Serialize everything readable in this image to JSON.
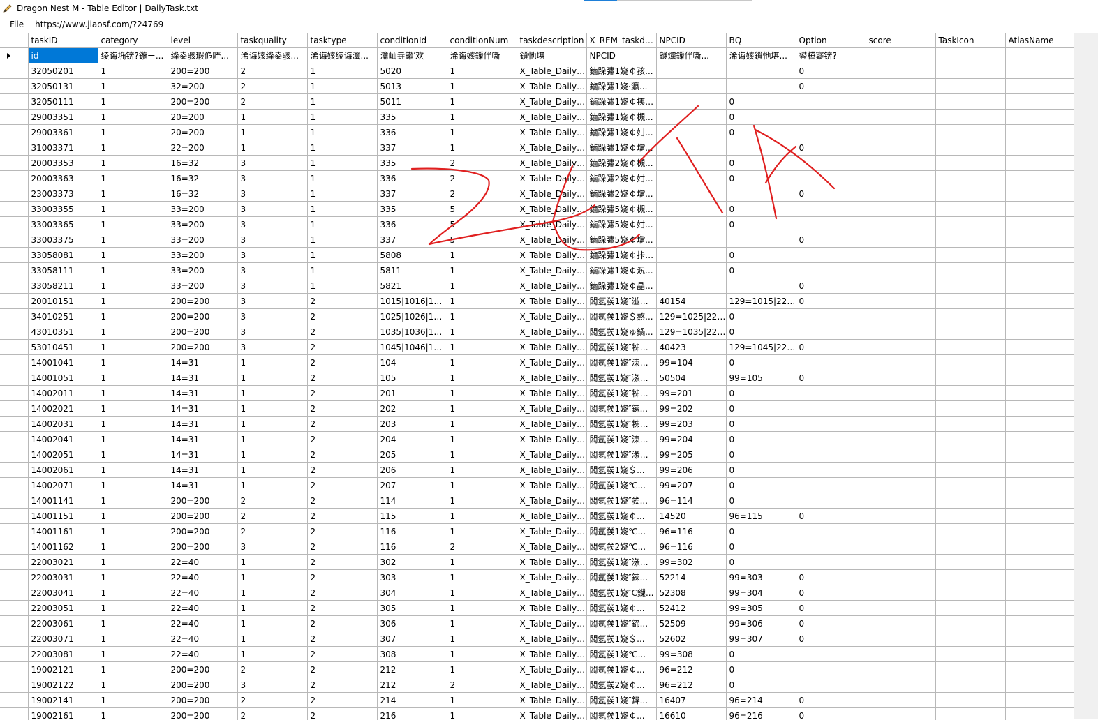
{
  "window": {
    "title": "Dragon Nest M - Table Editor | DailyTask.txt",
    "icon": "pencil-icon",
    "progress": 0.2
  },
  "menu": {
    "file_label": "File",
    "url_text": "https://www.jiaosf.com/?24769"
  },
  "grid": {
    "columns": [
      "taskID",
      "category",
      "level",
      "taskquality",
      "tasktype",
      "conditionId",
      "conditionNum",
      "taskdescription",
      "X_REM_taskdescri",
      "NPCID",
      "BQ",
      "Option",
      "score",
      "TaskIcon",
      "AtlasName"
    ],
    "header_row": [
      "id",
      "绫诲埆锛?鍦ㄧ...",
      "绛夌骇瑕佹眰...",
      "浠诲姟绛夌骇...",
      "浠诲姟绫诲瀷...",
      "瀹屾垚鏉′欢",
      "浠诲姟鏁伴噺",
      "鎻忚堪",
      "NPCID",
      "鐩爣鏁伴噺...",
      "浠诲姟鎻忚堪...",
      "鍙樺寲锛?",
      "",
      "",
      ""
    ],
    "rows": [
      [
        "32050201",
        "1",
        "200=200",
        "2",
        "1",
        "5020",
        "1",
        "X_Table_DailyTa...",
        "鏀跺彇1娆￠孩...",
        "",
        "",
        "0",
        "",
        "",
        ""
      ],
      [
        "32050131",
        "1",
        "32=200",
        "2",
        "1",
        "5013",
        "1",
        "X_Table_DailyTa...",
        "鏀跺彇1娆·瀛...",
        "",
        "",
        "0",
        "",
        "",
        ""
      ],
      [
        "32050111",
        "1",
        "200=200",
        "2",
        "1",
        "5011",
        "1",
        "X_Table_DailyTa...",
        "鏀跺彇1娆￠挗鍧?",
        "",
        "0",
        "",
        "",
        "",
        ""
      ],
      [
        "29003351",
        "1",
        "20=200",
        "1",
        "1",
        "335",
        "1",
        "X_Table_DailyTa...",
        "鏀跺彇1娆￠槻...",
        "",
        "0",
        "",
        "",
        "",
        ""
      ],
      [
        "29003361",
        "1",
        "20=200",
        "1",
        "1",
        "336",
        "1",
        "X_Table_DailyTa...",
        "鏀跺彇1娆￠姏...",
        "",
        "0",
        "",
        "",
        "",
        ""
      ],
      [
        "31003371",
        "1",
        "22=200",
        "1",
        "1",
        "337",
        "1",
        "X_Table_DailyTa...",
        "鏀跺彇1娆￠壋...",
        "",
        "",
        "0",
        "",
        "",
        ""
      ],
      [
        "20003353",
        "1",
        "16=32",
        "3",
        "1",
        "335",
        "2",
        "X_Table_DailyTa...",
        "鏀跺彇2娆￠槻...",
        "",
        "0",
        "",
        "",
        "",
        ""
      ],
      [
        "20003363",
        "1",
        "16=32",
        "3",
        "1",
        "336",
        "2",
        "X_Table_DailyTa...",
        "鏀跺彇2娆￠姏...",
        "",
        "0",
        "",
        "",
        "",
        ""
      ],
      [
        "23003373",
        "1",
        "16=32",
        "3",
        "1",
        "337",
        "2",
        "X_Table_DailyTa...",
        "鏀跺彇2娆￠壋...",
        "",
        "",
        "0",
        "",
        "",
        ""
      ],
      [
        "33003355",
        "1",
        "33=200",
        "3",
        "1",
        "335",
        "5",
        "X_Table_DailyTa...",
        "鏀跺彇5娆￠槻...",
        "",
        "0",
        "",
        "",
        "",
        ""
      ],
      [
        "33003365",
        "1",
        "33=200",
        "3",
        "1",
        "336",
        "5",
        "X_Table_DailyTa...",
        "鏀跺彇5娆￠姏...",
        "",
        "0",
        "",
        "",
        "",
        ""
      ],
      [
        "33003375",
        "1",
        "33=200",
        "3",
        "1",
        "337",
        "5",
        "X_Table_DailyTa...",
        "鏀跺彇5娆￠壋...",
        "",
        "",
        "0",
        "",
        "",
        ""
      ],
      [
        "33058081",
        "1",
        "33=200",
        "3",
        "1",
        "5808",
        "1",
        "X_Table_DailyTa...",
        "鏀跺彇1娆￠拤鏉?",
        "",
        "0",
        "",
        "",
        "",
        ""
      ],
      [
        "33058111",
        "1",
        "33=200",
        "3",
        "1",
        "5811",
        "1",
        "X_Table_DailyTa...",
        "鏀跺彇1娆￠泦...",
        "",
        "0",
        "",
        "",
        "",
        ""
      ],
      [
        "33058211",
        "1",
        "33=200",
        "3",
        "1",
        "5821",
        "1",
        "X_Table_DailyTa...",
        "鏀跺彇1娆￠晶...",
        "",
        "",
        "0",
        "",
        "",
        ""
      ],
      [
        "20010151",
        "1",
        "200=200",
        "3",
        "2",
        "1015|1016|1017|...",
        "1",
        "X_Table_DailyTa...",
        "闆氬彂1娆″湴鐩...",
        "40154",
        "129=1015|220=1...",
        "0",
        "",
        "",
        ""
      ],
      [
        "34010251",
        "1",
        "200=200",
        "3",
        "2",
        "1025|1026|1027|...",
        "1",
        "X_Table_DailyTa...",
        "闆氬彂1娆＄熬...",
        "129=1025|220=1...",
        "0",
        "",
        "",
        "",
        ""
      ],
      [
        "43010351",
        "1",
        "200=200",
        "3",
        "2",
        "1035|1036|1037|...",
        "1",
        "X_Table_DailyTa...",
        "闆氬彂1娆ゅ鍋...",
        "129=1035|220=1...",
        "0",
        "",
        "",
        "",
        ""
      ],
      [
        "53010451",
        "1",
        "200=200",
        "3",
        "2",
        "1045|1046|1047|...",
        "1",
        "X_Table_DailyTa...",
        "闆氬彂1娆″牬鐨...",
        "40423",
        "129=1045|220=1...",
        "0",
        "",
        "",
        ""
      ],
      [
        "14001041",
        "1",
        "14=31",
        "1",
        "2",
        "104",
        "1",
        "X_Table_DailyTa...",
        "闆氬彂1娆″洓鍦...",
        "99=104",
        "0",
        "",
        "",
        "",
        ""
      ],
      [
        "14001051",
        "1",
        "14=31",
        "1",
        "2",
        "105",
        "1",
        "X_Table_DailyTa...",
        "闆氬彂1娆″湪鐨...",
        "50504",
        "99=105",
        "0",
        "",
        "",
        ""
      ],
      [
        "14002011",
        "1",
        "14=31",
        "1",
        "2",
        "201",
        "1",
        "X_Table_DailyTa...",
        "闆氬彂1娆″牬鐨...",
        "99=201",
        "0",
        "",
        "",
        "",
        ""
      ],
      [
        "14002021",
        "1",
        "14=31",
        "1",
        "2",
        "202",
        "1",
        "X_Table_DailyTa...",
        "闆氬彂1娆″鍊...",
        "99=202",
        "0",
        "",
        "",
        "",
        ""
      ],
      [
        "14002031",
        "1",
        "14=31",
        "1",
        "2",
        "203",
        "1",
        "X_Table_DailyTa...",
        "闆氬彂1娆″牬鐨...",
        "99=203",
        "0",
        "",
        "",
        "",
        ""
      ],
      [
        "14002041",
        "1",
        "14=31",
        "1",
        "2",
        "204",
        "1",
        "X_Table_DailyTa...",
        "闆氬彂1娆″洓鍦...",
        "99=204",
        "0",
        "",
        "",
        "",
        ""
      ],
      [
        "14002051",
        "1",
        "14=31",
        "1",
        "2",
        "205",
        "1",
        "X_Table_DailyTa...",
        "闆氬彂1娆″湪鐨...",
        "99=205",
        "0",
        "",
        "",
        "",
        ""
      ],
      [
        "14002061",
        "1",
        "14=31",
        "1",
        "2",
        "206",
        "1",
        "X_Table_DailyTa...",
        "闆氬彂1娆＄...",
        "99=206",
        "0",
        "",
        "",
        "",
        ""
      ],
      [
        "14002071",
        "1",
        "14=31",
        "1",
        "2",
        "207",
        "1",
        "X_Table_DailyTa...",
        "闆氬彂1娆℃...",
        "99=207",
        "0",
        "",
        "",
        "",
        ""
      ],
      [
        "14001141",
        "1",
        "200=200",
        "2",
        "2",
        "114",
        "1",
        "X_Table_DailyTa...",
        "闆氬彂1娆″彂...",
        "96=114",
        "0",
        "",
        "",
        "",
        ""
      ],
      [
        "14001151",
        "1",
        "200=200",
        "2",
        "2",
        "115",
        "1",
        "X_Table_DailyTa...",
        "闆氬彂1娆￠...",
        "14520",
        "96=115",
        "0",
        "",
        "",
        ""
      ],
      [
        "14001161",
        "1",
        "200=200",
        "2",
        "2",
        "116",
        "1",
        "X_Table_DailyTa...",
        "闆氬彂1娆℃...",
        "96=116",
        "0",
        "",
        "",
        "",
        ""
      ],
      [
        "14001162",
        "1",
        "200=200",
        "3",
        "2",
        "116",
        "2",
        "X_Table_DailyTa...",
        "闆氬彂2娆℃...",
        "96=116",
        "0",
        "",
        "",
        "",
        ""
      ],
      [
        "22003021",
        "1",
        "22=40",
        "1",
        "2",
        "302",
        "1",
        "X_Table_DailyTa...",
        "闆氬彂1娆″湪鐨...",
        "99=302",
        "0",
        "",
        "",
        "",
        ""
      ],
      [
        "22003031",
        "1",
        "22=40",
        "1",
        "2",
        "303",
        "1",
        "X_Table_DailyTa...",
        "闆氬彂1娆″鍊...",
        "52214",
        "99=303",
        "0",
        "",
        "",
        ""
      ],
      [
        "22003041",
        "1",
        "22=40",
        "1",
        "2",
        "304",
        "1",
        "X_Table_DailyTa...",
        "闆氬彂1娆″C鏁...",
        "52308",
        "99=304",
        "0",
        "",
        "",
        ""
      ],
      [
        "22003051",
        "1",
        "22=40",
        "1",
        "2",
        "305",
        "1",
        "X_Table_DailyTa...",
        "闆氬彂1娆￠...",
        "52412",
        "99=305",
        "0",
        "",
        "",
        ""
      ],
      [
        "22003061",
        "1",
        "22=40",
        "1",
        "2",
        "306",
        "1",
        "X_Table_DailyTa...",
        "闆氬彂1娆″鍗...",
        "52509",
        "99=306",
        "0",
        "",
        "",
        ""
      ],
      [
        "22003071",
        "1",
        "22=40",
        "1",
        "2",
        "307",
        "1",
        "X_Table_DailyTa...",
        "闆氬彂1娆＄...",
        "52602",
        "99=307",
        "0",
        "",
        "",
        ""
      ],
      [
        "22003081",
        "1",
        "22=40",
        "1",
        "2",
        "308",
        "1",
        "X_Table_DailyTa...",
        "闆氬彂1娆℃...",
        "99=308",
        "0",
        "",
        "",
        "",
        ""
      ],
      [
        "19002121",
        "1",
        "200=200",
        "2",
        "2",
        "212",
        "1",
        "X_Table_DailyTa...",
        "闆氬彂1娆￠...",
        "96=212",
        "0",
        "",
        "",
        "",
        ""
      ],
      [
        "19002122",
        "1",
        "200=200",
        "3",
        "2",
        "212",
        "2",
        "X_Table_DailyTa...",
        "闆氬彂2娆￠...",
        "96=212",
        "0",
        "",
        "",
        "",
        ""
      ],
      [
        "19002141",
        "1",
        "200=200",
        "2",
        "2",
        "214",
        "1",
        "X_Table_DailyTa...",
        "闆氬彂1娆″鍏...",
        "16407",
        "96=214",
        "0",
        "",
        "",
        ""
      ],
      [
        "19002161",
        "1",
        "200=200",
        "2",
        "2",
        "216",
        "1",
        "X_Table_DailyTa...",
        "闆氬彂1娆￠...",
        "16610",
        "96=216",
        "0",
        "",
        "",
        ""
      ]
    ]
  },
  "annotation": {
    "color": "#e02020"
  }
}
